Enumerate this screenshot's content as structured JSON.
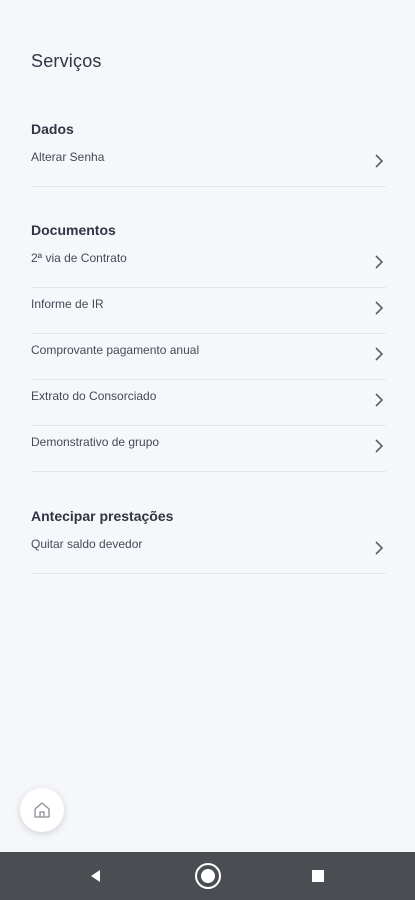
{
  "page": {
    "title": "Serviços"
  },
  "sections": [
    {
      "title": "Dados",
      "items": [
        {
          "label": "Alterar Senha"
        }
      ]
    },
    {
      "title": "Documentos",
      "items": [
        {
          "label": "2ª via de Contrato"
        },
        {
          "label": "Informe de IR"
        },
        {
          "label": "Comprovante pagamento anual"
        },
        {
          "label": "Extrato do Consorciado"
        },
        {
          "label": "Demonstrativo de grupo"
        }
      ]
    },
    {
      "title": "Antecipar prestações",
      "items": [
        {
          "label": "Quitar saldo devedor"
        }
      ]
    }
  ],
  "icons": {
    "chevron": "chevron-right-icon",
    "home": "home-icon",
    "nav_back": "back-triangle-icon",
    "nav_home": "home-circle-icon",
    "nav_recents": "recents-square-icon"
  },
  "colors": {
    "background": "#f5f7fb",
    "text": "#2f3542",
    "divider": "#e2e6ee",
    "navbar": "#4a4d52"
  }
}
